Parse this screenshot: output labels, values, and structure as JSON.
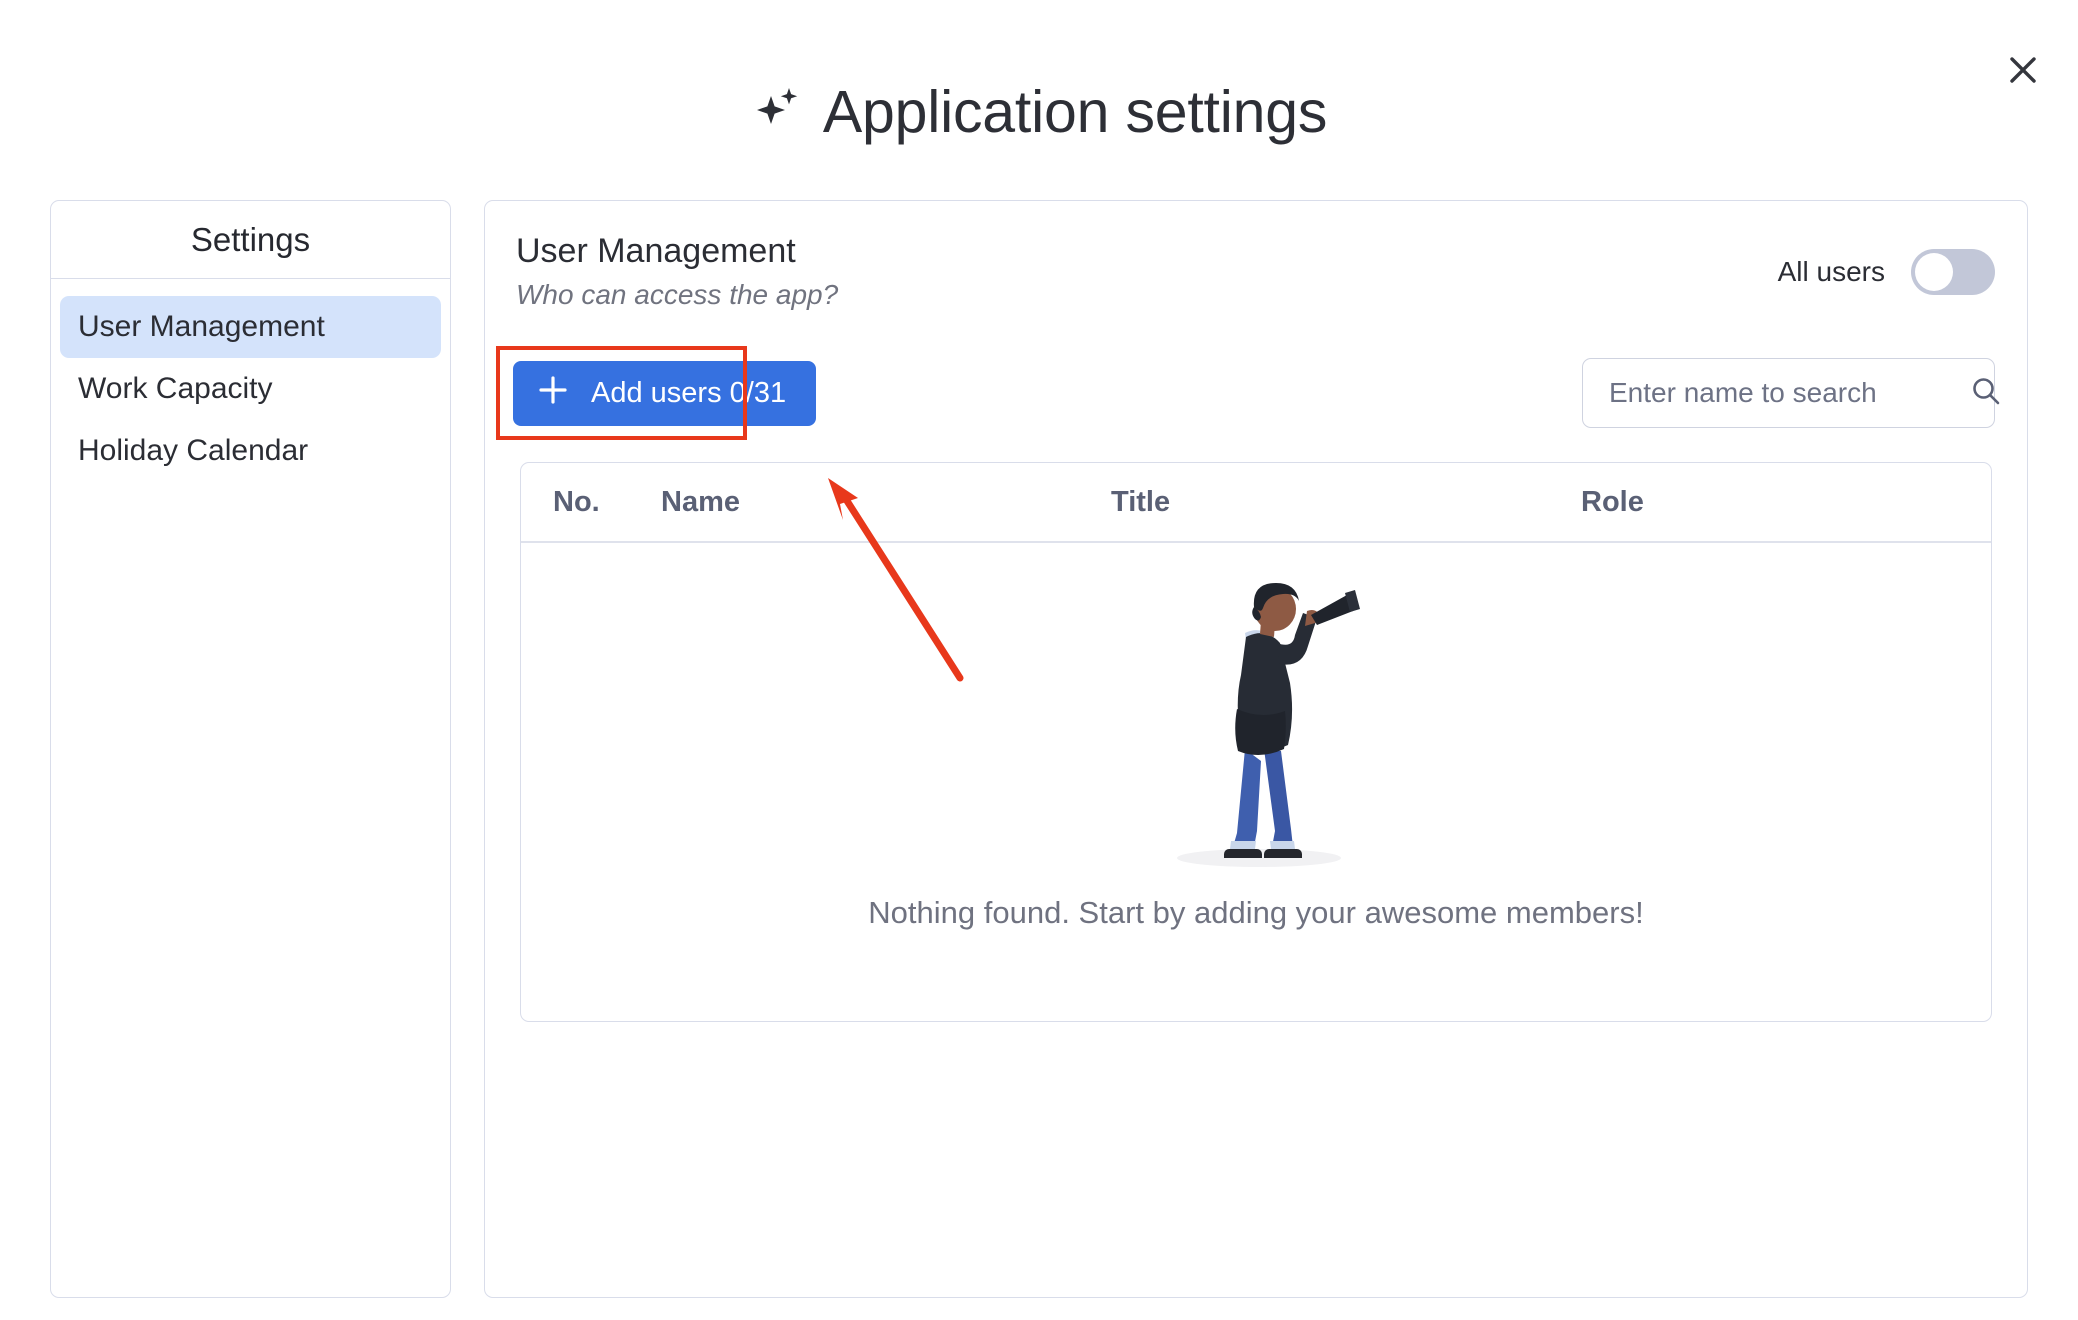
{
  "window": {
    "title": "Application settings",
    "title_icon": "sparkles-icon",
    "close_icon": "close-icon"
  },
  "sidebar": {
    "header": "Settings",
    "items": [
      {
        "label": "User Management",
        "active": true
      },
      {
        "label": "Work Capacity",
        "active": false
      },
      {
        "label": "Holiday Calendar",
        "active": false
      }
    ]
  },
  "main": {
    "title": "User Management",
    "subtitle": "Who can access the app?",
    "all_users": {
      "label": "All users",
      "toggle_state": "off"
    },
    "add_button": {
      "label": "Add users 0/31",
      "icon": "plus-icon",
      "count_current": 0,
      "count_max": 31,
      "highlighted": true
    },
    "search": {
      "placeholder": "Enter name to search",
      "value": "",
      "icon": "search-icon"
    },
    "table": {
      "columns": [
        "No.",
        "Name",
        "Title",
        "Role"
      ],
      "rows": [],
      "empty_message": "Nothing found. Start by adding your awesome members!",
      "empty_illustration": "person-with-telescope-illustration"
    }
  },
  "annotations": {
    "highlight_box_color": "#e8381b",
    "arrow_color": "#e8381b",
    "arrow_target": "add-users-button"
  },
  "colors": {
    "accent_blue": "#3671e0",
    "sidebar_active": "#d4e3fb",
    "border": "#d9ddea",
    "toggle_track": "#c2c7d8",
    "muted_text": "#6f7280"
  }
}
